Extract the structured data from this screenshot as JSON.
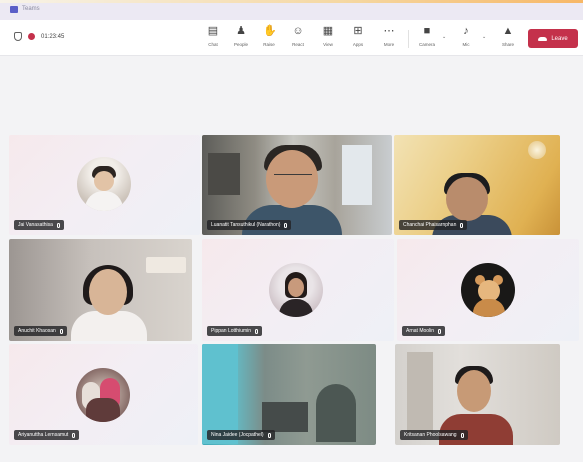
{
  "app": {
    "window_title": "Teams"
  },
  "toolbar": {
    "timer": "01:23:45",
    "buttons": [
      {
        "label": "Chat",
        "icon": "chat-icon"
      },
      {
        "label": "People",
        "icon": "people-icon"
      },
      {
        "label": "Raise",
        "icon": "raise-hand-icon"
      },
      {
        "label": "React",
        "icon": "react-icon"
      },
      {
        "label": "View",
        "icon": "view-icon"
      },
      {
        "label": "Apps",
        "icon": "apps-icon"
      },
      {
        "label": "More",
        "icon": "more-icon"
      },
      {
        "label": "Camera",
        "icon": "camera-icon"
      },
      {
        "label": "Mic",
        "icon": "mic-icon"
      },
      {
        "label": "Share",
        "icon": "share-icon"
      }
    ],
    "leave_label": "Leave"
  },
  "colors": {
    "accent": "#5b5fc7",
    "leave": "#c4314b",
    "recording": "#c4314b"
  },
  "participants": [
    {
      "name": "Jai Vanasathisa"
    },
    {
      "name": "Luanatit Tansuthikul (Narathon)"
    },
    {
      "name": "Chanchai Phaisarnphan"
    },
    {
      "name": "Anuchit Khaosan"
    },
    {
      "name": "Pippan Lotthiumin"
    },
    {
      "name": "Arnat Moolin"
    },
    {
      "name": "Ariyanuttha Lernsamut"
    },
    {
      "name": "Nina Jaidee (Jocpathel)"
    },
    {
      "name": "Kritsanan Phoolsawang"
    }
  ]
}
